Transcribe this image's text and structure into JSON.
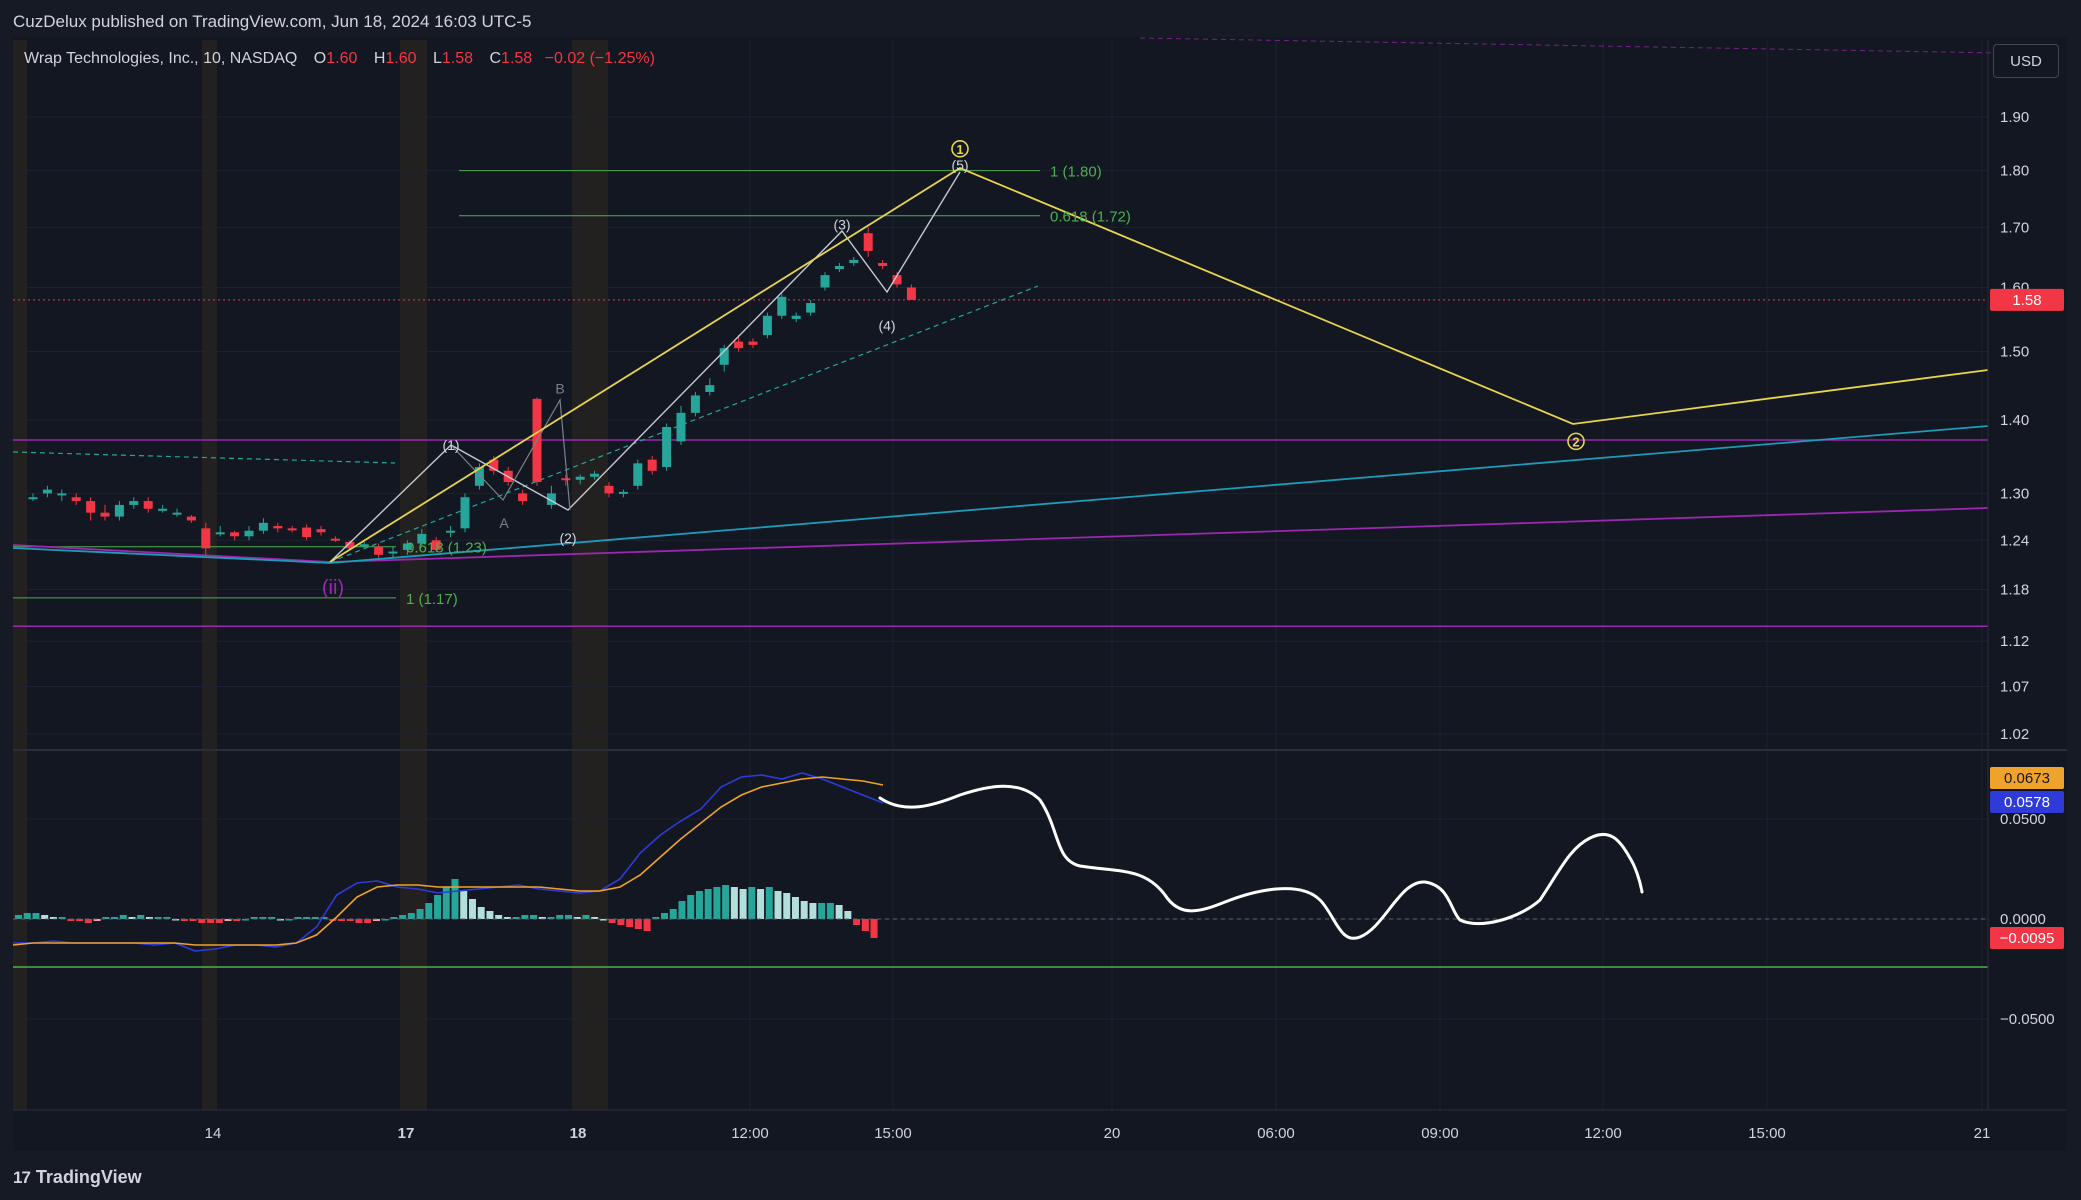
{
  "publisher": "CuzDelux published on TradingView.com, Jun 18, 2024 16:03 UTC-5",
  "legend": {
    "symbol": "Wrap Technologies, Inc., 10, NASDAQ",
    "open_label": "O",
    "open": "1.60",
    "high_label": "H",
    "high": "1.60",
    "low_label": "L",
    "low": "1.58",
    "close_label": "C",
    "close": "1.58",
    "change": "−0.02 (−1.25%)"
  },
  "currency": "USD",
  "footer_logo": "TradingView",
  "colors": {
    "up": "#26a69a",
    "down": "#f23645",
    "fib": "#4caf50",
    "yellow": "#e8d44d",
    "purple": "#9c27b0",
    "cyan": "#1e9bb8",
    "macd": "#2f3bd9",
    "signal": "#f0a32a"
  },
  "chart_data": [
    {
      "type": "candlestick",
      "symbol": "Wrap Technologies, Inc., 10, NASDAQ",
      "x_ticks": [
        "14",
        "17",
        "18",
        "12:00",
        "15:00",
        "20",
        "06:00",
        "09:00",
        "12:00",
        "15:00",
        "21"
      ],
      "y_ticks": [
        "1.90",
        "1.80",
        "1.70",
        "1.60",
        "1.50",
        "1.40",
        "1.30",
        "1.24",
        "1.18",
        "1.12",
        "1.07",
        "1.02"
      ],
      "y_scale": "log",
      "last_price_label": "1.58",
      "candles": [
        {
          "i": 0,
          "o": 1.295,
          "h": 1.3,
          "l": 1.29,
          "c": 1.295
        },
        {
          "i": 1,
          "o": 1.3,
          "h": 1.31,
          "l": 1.295,
          "c": 1.305
        },
        {
          "i": 2,
          "o": 1.3,
          "h": 1.305,
          "l": 1.29,
          "c": 1.3
        },
        {
          "i": 3,
          "o": 1.295,
          "h": 1.3,
          "l": 1.285,
          "c": 1.29
        },
        {
          "i": 4,
          "o": 1.29,
          "h": 1.295,
          "l": 1.265,
          "c": 1.275
        },
        {
          "i": 5,
          "o": 1.275,
          "h": 1.285,
          "l": 1.265,
          "c": 1.27
        },
        {
          "i": 6,
          "o": 1.27,
          "h": 1.29,
          "l": 1.265,
          "c": 1.285
        },
        {
          "i": 7,
          "o": 1.285,
          "h": 1.295,
          "l": 1.28,
          "c": 1.29
        },
        {
          "i": 8,
          "o": 1.29,
          "h": 1.295,
          "l": 1.275,
          "c": 1.28
        },
        {
          "i": 9,
          "o": 1.28,
          "h": 1.285,
          "l": 1.275,
          "c": 1.28
        },
        {
          "i": 10,
          "o": 1.275,
          "h": 1.28,
          "l": 1.27,
          "c": 1.275
        },
        {
          "i": 11,
          "o": 1.27,
          "h": 1.272,
          "l": 1.262,
          "c": 1.265
        },
        {
          "i": 12,
          "o": 1.255,
          "h": 1.262,
          "l": 1.22,
          "c": 1.23
        },
        {
          "i": 13,
          "o": 1.25,
          "h": 1.258,
          "l": 1.245,
          "c": 1.25
        },
        {
          "i": 14,
          "o": 1.25,
          "h": 1.252,
          "l": 1.24,
          "c": 1.245
        },
        {
          "i": 15,
          "o": 1.245,
          "h": 1.258,
          "l": 1.24,
          "c": 1.252
        },
        {
          "i": 16,
          "o": 1.252,
          "h": 1.268,
          "l": 1.248,
          "c": 1.262
        },
        {
          "i": 17,
          "o": 1.258,
          "h": 1.262,
          "l": 1.25,
          "c": 1.255
        },
        {
          "i": 18,
          "o": 1.255,
          "h": 1.258,
          "l": 1.25,
          "c": 1.254
        },
        {
          "i": 19,
          "o": 1.256,
          "h": 1.26,
          "l": 1.24,
          "c": 1.244
        },
        {
          "i": 20,
          "o": 1.254,
          "h": 1.258,
          "l": 1.246,
          "c": 1.25
        },
        {
          "i": 21,
          "o": 1.242,
          "h": 1.245,
          "l": 1.238,
          "c": 1.24
        },
        {
          "i": 22,
          "o": 1.238,
          "h": 1.24,
          "l": 1.228,
          "c": 1.23
        },
        {
          "i": 23,
          "o": 1.234,
          "h": 1.238,
          "l": 1.23,
          "c": 1.235
        },
        {
          "i": 24,
          "o": 1.232,
          "h": 1.236,
          "l": 1.218,
          "c": 1.222
        },
        {
          "i": 25,
          "o": 1.225,
          "h": 1.232,
          "l": 1.218,
          "c": 1.226
        },
        {
          "i": 26,
          "o": 1.228,
          "h": 1.24,
          "l": 1.222,
          "c": 1.236
        },
        {
          "i": 27,
          "o": 1.236,
          "h": 1.254,
          "l": 1.232,
          "c": 1.248
        },
        {
          "i": 28,
          "o": 1.24,
          "h": 1.244,
          "l": 1.225,
          "c": 1.228
        },
        {
          "i": 29,
          "o": 1.25,
          "h": 1.258,
          "l": 1.244,
          "c": 1.252
        },
        {
          "i": 30,
          "o": 1.255,
          "h": 1.3,
          "l": 1.25,
          "c": 1.295
        },
        {
          "i": 31,
          "o": 1.31,
          "h": 1.34,
          "l": 1.305,
          "c": 1.335
        },
        {
          "i": 32,
          "o": 1.345,
          "h": 1.35,
          "l": 1.325,
          "c": 1.33
        },
        {
          "i": 33,
          "o": 1.33,
          "h": 1.335,
          "l": 1.31,
          "c": 1.315
        },
        {
          "i": 34,
          "o": 1.3,
          "h": 1.305,
          "l": 1.285,
          "c": 1.29
        },
        {
          "i": 35,
          "o": 1.43,
          "h": 1.432,
          "l": 1.31,
          "c": 1.315
        },
        {
          "i": 36,
          "o": 1.285,
          "h": 1.31,
          "l": 1.28,
          "c": 1.3
        },
        {
          "i": 37,
          "o": 1.32,
          "h": 1.325,
          "l": 1.31,
          "c": 1.318
        },
        {
          "i": 38,
          "o": 1.318,
          "h": 1.325,
          "l": 1.312,
          "c": 1.322
        },
        {
          "i": 39,
          "o": 1.322,
          "h": 1.33,
          "l": 1.318,
          "c": 1.326
        },
        {
          "i": 40,
          "o": 1.31,
          "h": 1.315,
          "l": 1.295,
          "c": 1.3
        },
        {
          "i": 41,
          "o": 1.3,
          "h": 1.305,
          "l": 1.295,
          "c": 1.302
        },
        {
          "i": 42,
          "o": 1.31,
          "h": 1.345,
          "l": 1.305,
          "c": 1.34
        },
        {
          "i": 43,
          "o": 1.345,
          "h": 1.35,
          "l": 1.325,
          "c": 1.33
        },
        {
          "i": 44,
          "o": 1.335,
          "h": 1.395,
          "l": 1.33,
          "c": 1.39
        },
        {
          "i": 45,
          "o": 1.37,
          "h": 1.42,
          "l": 1.365,
          "c": 1.41
        },
        {
          "i": 46,
          "o": 1.41,
          "h": 1.44,
          "l": 1.405,
          "c": 1.435
        },
        {
          "i": 47,
          "o": 1.44,
          "h": 1.46,
          "l": 1.435,
          "c": 1.45
        },
        {
          "i": 48,
          "o": 1.48,
          "h": 1.51,
          "l": 1.47,
          "c": 1.505
        },
        {
          "i": 49,
          "o": 1.515,
          "h": 1.525,
          "l": 1.5,
          "c": 1.505
        },
        {
          "i": 50,
          "o": 1.515,
          "h": 1.52,
          "l": 1.505,
          "c": 1.51
        },
        {
          "i": 51,
          "o": 1.525,
          "h": 1.56,
          "l": 1.52,
          "c": 1.555
        },
        {
          "i": 52,
          "o": 1.555,
          "h": 1.59,
          "l": 1.55,
          "c": 1.585
        },
        {
          "i": 53,
          "o": 1.55,
          "h": 1.56,
          "l": 1.545,
          "c": 1.555
        },
        {
          "i": 54,
          "o": 1.56,
          "h": 1.58,
          "l": 1.555,
          "c": 1.575
        },
        {
          "i": 55,
          "o": 1.6,
          "h": 1.625,
          "l": 1.595,
          "c": 1.62
        },
        {
          "i": 56,
          "o": 1.63,
          "h": 1.64,
          "l": 1.625,
          "c": 1.635
        },
        {
          "i": 57,
          "o": 1.64,
          "h": 1.65,
          "l": 1.635,
          "c": 1.645
        },
        {
          "i": 58,
          "o": 1.69,
          "h": 1.7,
          "l": 1.65,
          "c": 1.66
        },
        {
          "i": 59,
          "o": 1.64,
          "h": 1.645,
          "l": 1.63,
          "c": 1.635
        },
        {
          "i": 60,
          "o": 1.62,
          "h": 1.625,
          "l": 1.6,
          "c": 1.605
        },
        {
          "i": 61,
          "o": 1.6,
          "h": 1.605,
          "l": 1.58,
          "c": 1.58
        }
      ],
      "fib_levels": [
        {
          "label": "1 (1.80)",
          "price": 1.8
        },
        {
          "label": "0.618 (1.72)",
          "price": 1.72
        },
        {
          "label": "0.618 (1.23)",
          "price": 1.232
        },
        {
          "label": "1 (1.17)",
          "price": 1.17
        }
      ],
      "wave_labels": [
        {
          "text": "(1)",
          "price": 1.365
        },
        {
          "text": "(2)",
          "price": 1.243
        },
        {
          "text": "(3)",
          "price": 1.705
        },
        {
          "text": "(4)",
          "price": 1.54
        },
        {
          "text": "(5)",
          "price": 1.81
        },
        {
          "text": "A",
          "price": 1.262
        },
        {
          "text": "B",
          "price": 1.445
        },
        {
          "text": "(ii)",
          "price": 1.182
        },
        {
          "text": "1",
          "price": 1.84
        },
        {
          "text": "2",
          "price": 1.37
        }
      ]
    },
    {
      "type": "macd",
      "y_ticks": [
        "0.0500",
        "0.0000",
        "−0.0500"
      ],
      "value_labels": {
        "signal": "0.0673",
        "macd": "0.0578",
        "histogram": "−0.0095"
      },
      "histogram": [
        0.002,
        0.003,
        0.003,
        0.002,
        0.001,
        0.001,
        -0.001,
        -0.001,
        -0.002,
        -0.001,
        0.001,
        0.001,
        0.002,
        0.001,
        0.002,
        0.001,
        0.001,
        0.001,
        0.0,
        -0.001,
        -0.001,
        -0.002,
        -0.002,
        -0.002,
        -0.001,
        -0.001,
        0.0,
        0.001,
        0.001,
        0.001,
        0.0,
        0.0,
        0.001,
        0.001,
        0.001,
        0.001,
        -0.001,
        -0.001,
        -0.001,
        -0.002,
        -0.002,
        -0.001,
        0.0,
        0.001,
        0.002,
        0.003,
        0.005,
        0.008,
        0.012,
        0.016,
        0.02,
        0.014,
        0.01,
        0.006,
        0.004,
        0.002,
        0.001,
        0.001,
        0.002,
        0.002,
        0.001,
        0.001,
        0.002,
        0.002,
        0.001,
        0.002,
        0.001,
        0.0,
        -0.002,
        -0.003,
        -0.004,
        -0.005,
        -0.006,
        0.001,
        0.003,
        0.005,
        0.009,
        0.012,
        0.014,
        0.015,
        0.016,
        0.017,
        0.016,
        0.015,
        0.016,
        0.015,
        0.016,
        0.014,
        0.013,
        0.011,
        0.009,
        0.008,
        0.008,
        0.008,
        0.007,
        0.004,
        -0.003,
        -0.006,
        -0.0095
      ],
      "macd": [
        -0.012,
        -0.012,
        -0.011,
        -0.012,
        -0.012,
        -0.012,
        -0.012,
        -0.013,
        -0.012,
        -0.016,
        -0.015,
        -0.013,
        -0.013,
        -0.014,
        -0.012,
        -0.004,
        0.012,
        0.018,
        0.019,
        0.016,
        0.015,
        0.013,
        0.014,
        0.015,
        0.016,
        0.017,
        0.015,
        0.014,
        0.013,
        0.014,
        0.02,
        0.033,
        0.042,
        0.049,
        0.055,
        0.066,
        0.071,
        0.072,
        0.07,
        0.073,
        0.07,
        0.066,
        0.062,
        0.058
      ],
      "signal": [
        -0.013,
        -0.012,
        -0.012,
        -0.012,
        -0.012,
        -0.012,
        -0.012,
        -0.012,
        -0.012,
        -0.013,
        -0.013,
        -0.013,
        -0.013,
        -0.013,
        -0.012,
        -0.008,
        0.001,
        0.011,
        0.016,
        0.017,
        0.017,
        0.016,
        0.016,
        0.016,
        0.016,
        0.016,
        0.016,
        0.015,
        0.014,
        0.014,
        0.016,
        0.022,
        0.031,
        0.04,
        0.048,
        0.056,
        0.062,
        0.066,
        0.068,
        0.07,
        0.071,
        0.07,
        0.069,
        0.067
      ],
      "zero_line": 0.0,
      "green_level": -0.024
    }
  ]
}
